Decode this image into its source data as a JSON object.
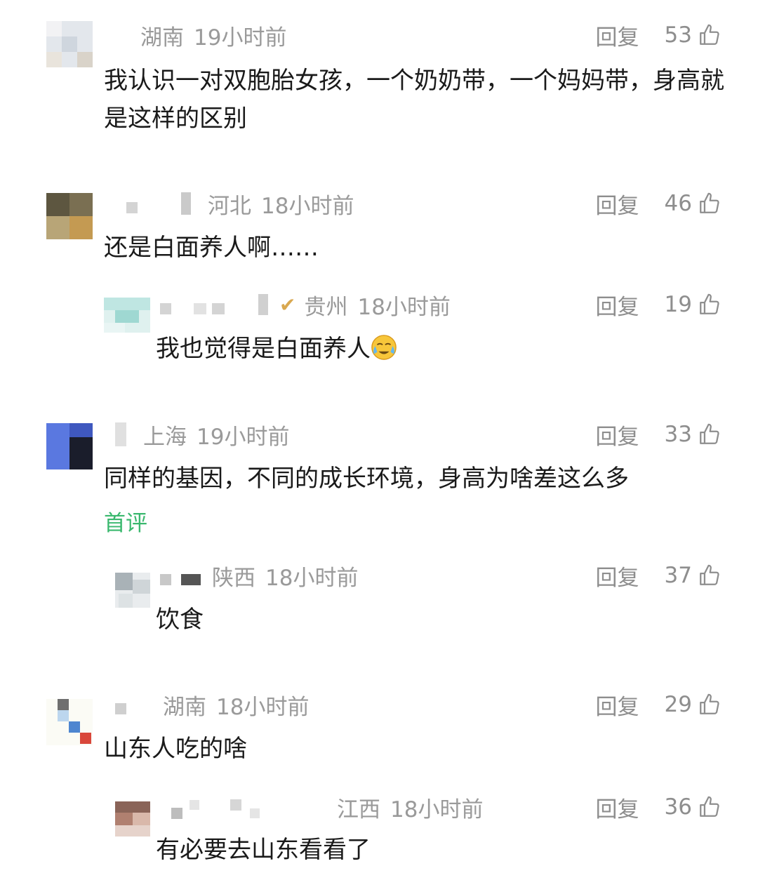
{
  "reply_label": "回复",
  "comments": [
    {
      "region": "湖南",
      "time": "19小时前",
      "likes": "53",
      "text": "我认识一对双胞胎女孩，一个奶奶带，一个妈妈带，身高就是这样的区别"
    },
    {
      "region": "河北",
      "time": "18小时前",
      "likes": "46",
      "text": "还是白面养人啊……",
      "replies": [
        {
          "region": "贵州",
          "time": "18小时前",
          "likes": "19",
          "text": "我也觉得是白面养人",
          "emoji": "crying-face-emoji"
        }
      ]
    },
    {
      "region": "上海",
      "time": "19小时前",
      "likes": "33",
      "text": "同样的基因，不同的成长环境，身高为啥差这么多",
      "badge": "首评",
      "replies": [
        {
          "region": "陕西",
          "time": "18小时前",
          "likes": "37",
          "text": "饮食"
        }
      ]
    },
    {
      "region": "湖南",
      "time": "18小时前",
      "likes": "29",
      "text": "山东人吃的啥",
      "replies": [
        {
          "region": "江西",
          "time": "18小时前",
          "likes": "36",
          "text": "有必要去山东看看了"
        }
      ]
    }
  ],
  "colors": {
    "meta": "#9a9a9a",
    "text": "#1a1a1a",
    "first_comment_badge": "#3ab86e",
    "background": "#ffffff"
  }
}
